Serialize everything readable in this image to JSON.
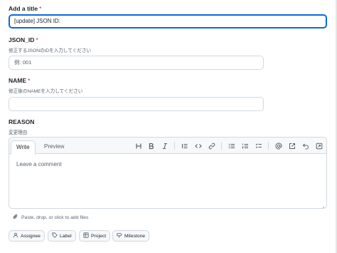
{
  "title_field": {
    "label": "Add a title",
    "required_mark": "*",
    "value": "[update] JSON ID:"
  },
  "json_id_field": {
    "label": "JSON_ID",
    "required_mark": "*",
    "hint": "修正するJSONのIDを入力してください",
    "placeholder": "例: 001"
  },
  "name_field": {
    "label": "NAME",
    "required_mark": "*",
    "hint": "修正後のNAMEを入力してください",
    "value": ""
  },
  "reason_field": {
    "label": "REASON",
    "hint": "変更理由"
  },
  "editor": {
    "tabs": [
      "Write",
      "Preview"
    ],
    "placeholder": "Leave a comment",
    "toolbar": [
      "heading-icon",
      "bold-icon",
      "italic-icon",
      "quote-icon",
      "code-icon",
      "link-icon",
      "unordered-list-icon",
      "ordered-list-icon",
      "task-list-icon",
      "mention-icon",
      "reference-icon",
      "undo-icon",
      "fullscreen-icon"
    ]
  },
  "attach_hint": "Paste, drop, or click to add files",
  "metadata_buttons": [
    {
      "label": "Assignee",
      "icon": "person-icon"
    },
    {
      "label": "Label",
      "icon": "tag-icon"
    },
    {
      "label": "Project",
      "icon": "table-icon"
    },
    {
      "label": "Milestone",
      "icon": "milestone-icon"
    }
  ],
  "colors": {
    "accent": "#0969da",
    "required": "#cf222e",
    "muted": "#59636e",
    "border": "#d1d9e0"
  }
}
